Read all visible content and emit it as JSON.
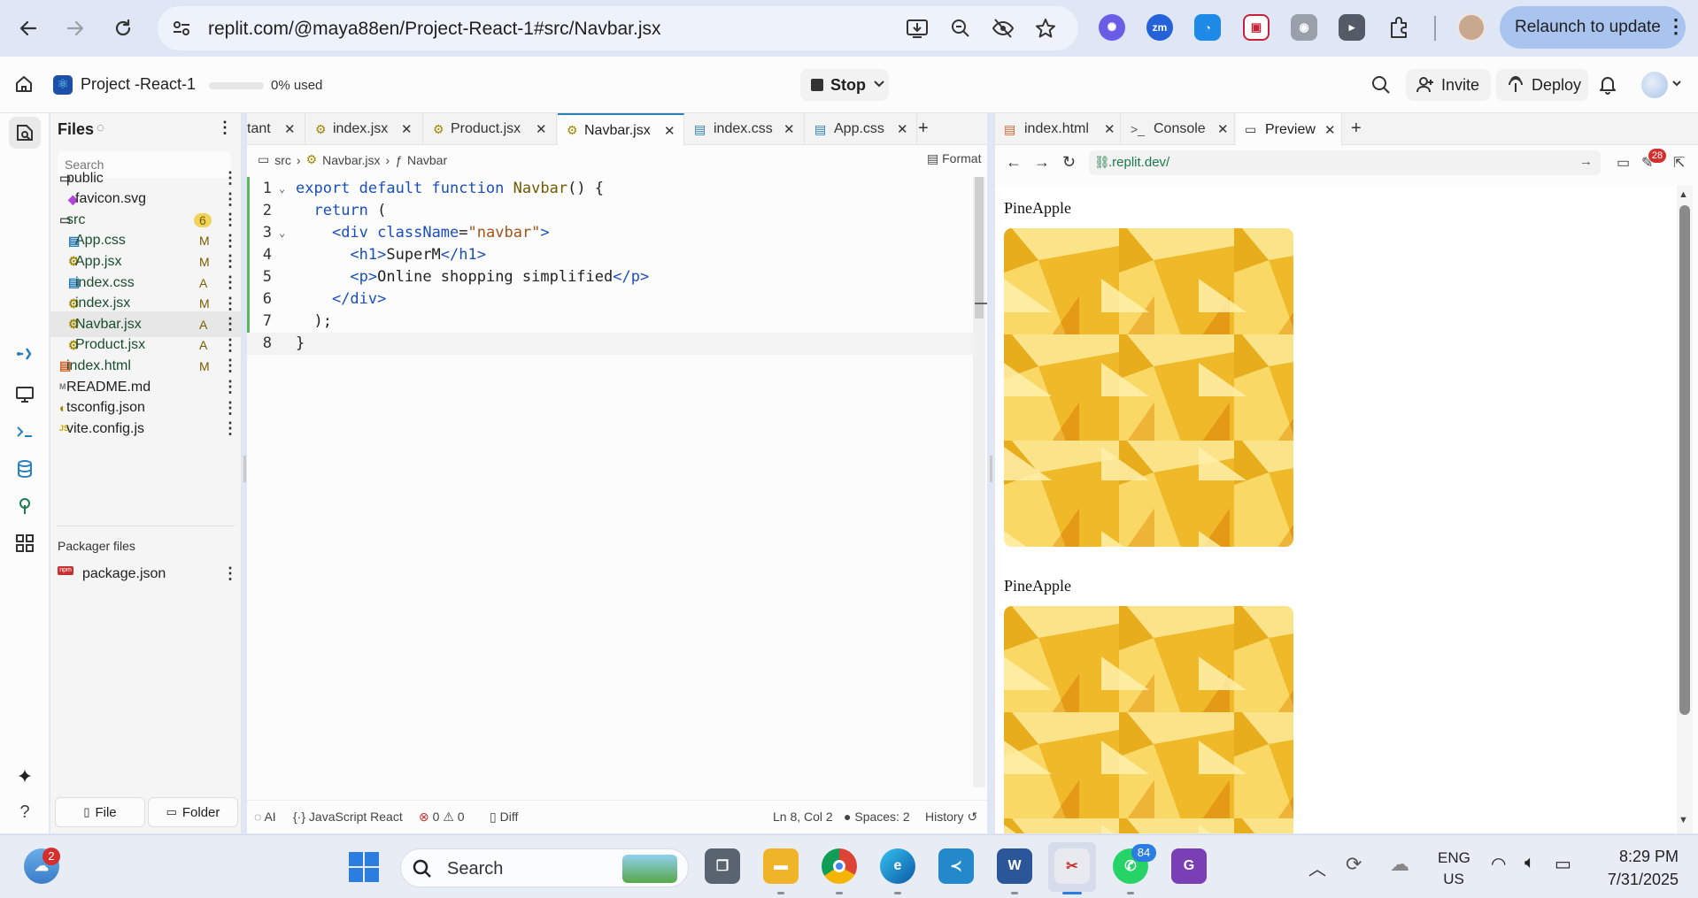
{
  "browser": {
    "url": "replit.com/@maya88en/Project-React-1#src/Navbar.jsx",
    "relaunch_label": "Relaunch to update",
    "ext_zm": "zm"
  },
  "header": {
    "project_name": "Project -React-1",
    "usage": "0% used",
    "stop_label": "Stop",
    "invite_label": "Invite",
    "deploy_label": "Deploy"
  },
  "files": {
    "title": "Files",
    "search_placeholder": "Search",
    "items": [
      {
        "name": "public",
        "badge": "",
        "type": "folder",
        "color": "#1f1f1f"
      },
      {
        "name": "favicon.svg",
        "badge": "",
        "type": "svg",
        "color": "#1f1f1f"
      },
      {
        "name": "src",
        "badge": "6",
        "type": "folder",
        "color": "#1a4d2e"
      },
      {
        "name": "App.css",
        "badge": "M",
        "type": "css",
        "color": "#1a4d2e"
      },
      {
        "name": "App.jsx",
        "badge": "M",
        "type": "react",
        "color": "#1a4d2e"
      },
      {
        "name": "index.css",
        "badge": "A",
        "type": "css",
        "color": "#1a4d2e"
      },
      {
        "name": "index.jsx",
        "badge": "M",
        "type": "react",
        "color": "#1a4d2e"
      },
      {
        "name": "Navbar.jsx",
        "badge": "A",
        "type": "react",
        "color": "#1a4d2e"
      },
      {
        "name": "Product.jsx",
        "badge": "A",
        "type": "react",
        "color": "#1a4d2e"
      },
      {
        "name": "index.html",
        "badge": "M",
        "type": "html",
        "color": "#1a4d2e"
      },
      {
        "name": "README.md",
        "badge": "",
        "type": "md",
        "color": "#1f1f1f"
      },
      {
        "name": "tsconfig.json",
        "badge": "",
        "type": "json",
        "color": "#1f1f1f"
      },
      {
        "name": "vite.config.js",
        "badge": "",
        "type": "js",
        "color": "#1f1f1f"
      }
    ],
    "packager_title": "Packager files",
    "package_json": "package.json",
    "file_button": "File",
    "folder_button": "Folder"
  },
  "editor": {
    "tabs": [
      "tant",
      "index.jsx",
      "Product.jsx",
      "Navbar.jsx",
      "index.css",
      "App.css"
    ],
    "active_tab": "Navbar.jsx",
    "breadcrumb": [
      "src",
      "Navbar.jsx",
      "Navbar"
    ],
    "format_label": "Format",
    "line_numbers": [
      "1",
      "2",
      "3",
      "4",
      "5",
      "6",
      "7",
      "8"
    ],
    "status": {
      "ai": "AI",
      "language": "JavaScript React",
      "errors": "0",
      "warnings": "0",
      "diff": "Diff",
      "position": "Ln 8, Col 2",
      "spaces": "Spaces: 2",
      "history": "History"
    }
  },
  "preview": {
    "tabs": [
      "index.html",
      "Console",
      "Preview"
    ],
    "url": ".replit.dev/",
    "notification_count": "28",
    "products": [
      "PineApple",
      "PineApple"
    ]
  },
  "taskbar": {
    "search_placeholder": "Search",
    "weather_badge": "2",
    "whatsapp_badge": "84",
    "lang_top": "ENG",
    "lang_bottom": "US",
    "time": "8:29 PM",
    "date": "7/31/2025",
    "word_letter": "W"
  }
}
